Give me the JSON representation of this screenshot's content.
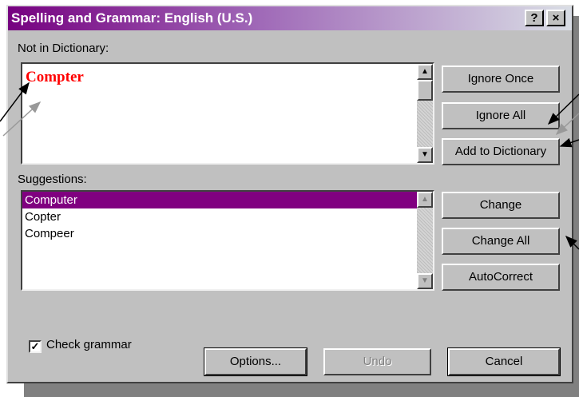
{
  "window": {
    "title": "Spelling and Grammar: English (U.S.)",
    "help_label": "?",
    "close_label": "×"
  },
  "not_in_dictionary": {
    "label": "Not in Dictionary:",
    "word": "Compter"
  },
  "suggestions": {
    "label": "Suggestions:",
    "items": [
      "Computer",
      "Copter",
      "Compeer"
    ],
    "selected_index": 0
  },
  "buttons": {
    "ignore_once": "Ignore Once",
    "ignore_all": "Ignore All",
    "add_to_dictionary": "Add to Dictionary",
    "change": "Change",
    "change_all": "Change All",
    "autocorrect": "AutoCorrect",
    "options": "Options...",
    "undo": "Undo",
    "cancel": "Cancel"
  },
  "check_grammar": {
    "label": "Check grammar",
    "checked": true
  },
  "colors": {
    "title_start": "#760080",
    "selection": "#800080",
    "error_word": "#ff0000"
  },
  "icons": [
    "help-icon",
    "close-icon",
    "scroll-up-icon",
    "scroll-down-icon",
    "checkmark-icon",
    "annotation-arrow"
  ]
}
